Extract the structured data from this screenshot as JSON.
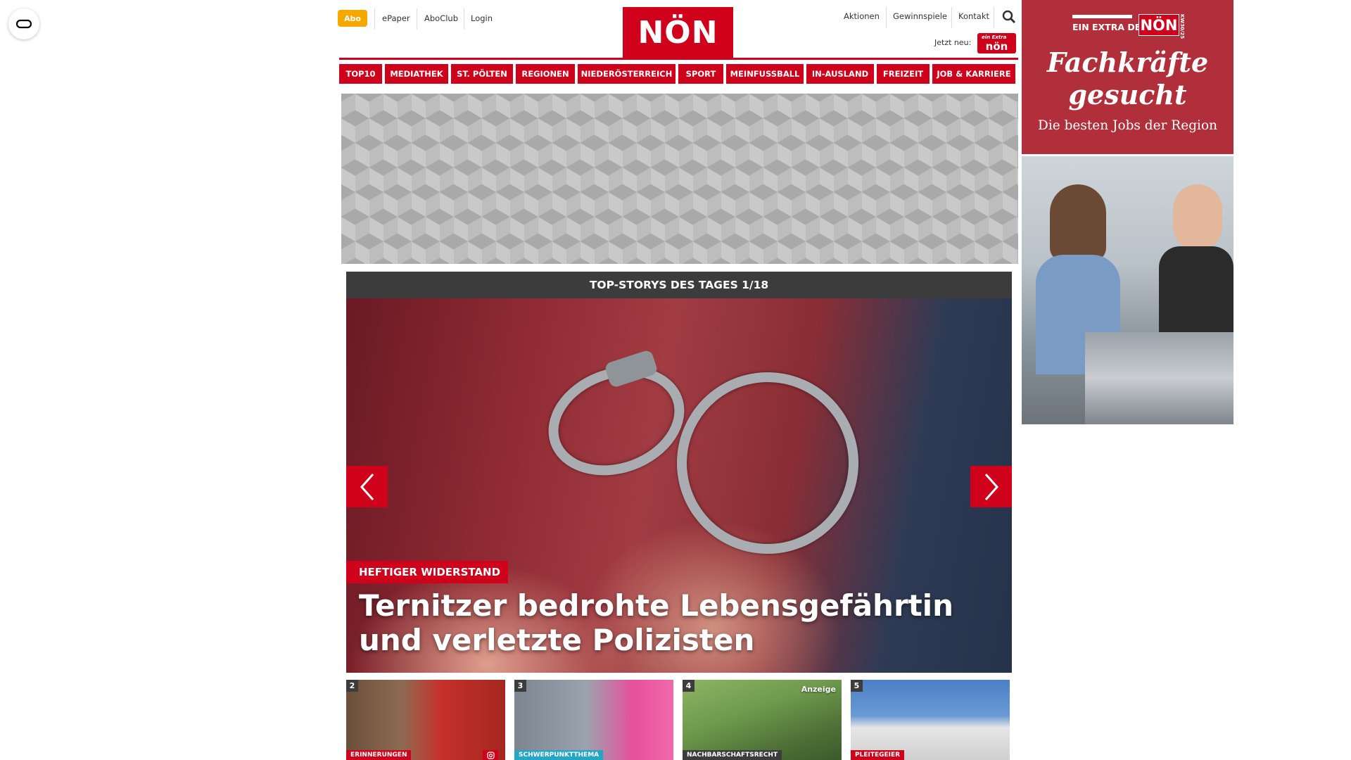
{
  "top_bar": {
    "abo": "Abo",
    "links": [
      "ePaper",
      "AboClub",
      "Login"
    ],
    "right_links": [
      "Aktionen",
      "Gewinnspiele",
      "Kontakt"
    ],
    "jetzt_neu": "Jetzt neu:",
    "weinviertel_script": "ein Extra",
    "weinviertel_logo": "nön"
  },
  "logo": {
    "text": "NÖN"
  },
  "nav": {
    "items": [
      "TOP10",
      "MEDIATHEK",
      "ST. PÖLTEN",
      "REGIONEN",
      "NIEDERÖSTERREICH",
      "SPORT",
      "MEINFUSSBALL",
      "IN-AUSLAND",
      "FREIZEIT",
      "JOB & KARRIERE"
    ]
  },
  "hero": {
    "header": "TOP-STORYS DES TAGES 1/18",
    "tag": "HEFTIGER WIDERSTAND",
    "title": "Ternitzer bedrohte Lebensgefährtin und verletzte Polizisten"
  },
  "thumbs": [
    {
      "num": "2",
      "category": "ERINNERUNGEN",
      "cat_color": "#d0021b"
    },
    {
      "num": "3",
      "category": "SCHWERPUNKTTHEMA",
      "cat_color": "#26a6c7"
    },
    {
      "num": "4",
      "category": "NACHBARSCHAFTSRECHT",
      "cat_color": "#3c3c3c",
      "badge": "Anzeige"
    },
    {
      "num": "5",
      "category": "PLEITEGEIER",
      "cat_color": "#d0021b"
    }
  ],
  "side_ad": {
    "extra_label": "EIN EXTRA DER",
    "extra_logo": "NÖN",
    "kw": "KW30/25",
    "headline_1": "Fachkräfte",
    "headline_2": "gesucht",
    "subline": "Die besten Jobs der Region"
  },
  "colors": {
    "brand_red": "#d0021b",
    "abo_orange": "#f5a800",
    "dark_header": "#3c3c3c",
    "ad_red": "#b12f3a"
  },
  "icons": [
    "reader-mode-icon",
    "search-icon",
    "arrow-left-icon",
    "arrow-right-icon",
    "instagram-icon"
  ]
}
